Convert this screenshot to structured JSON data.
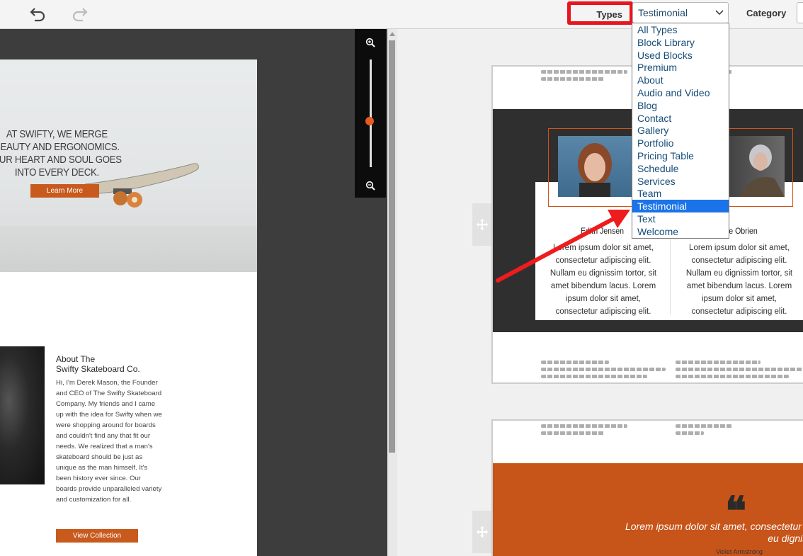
{
  "toolbar": {
    "undo_icon": "undo-icon",
    "redo_icon": "redo-icon",
    "types_label": "Types",
    "types_value": "Testimonial",
    "category_label": "Category"
  },
  "dropdown": {
    "options": [
      "All Types",
      "Block Library",
      "Used Blocks",
      "Premium",
      "About",
      "Audio and Video",
      "Blog",
      "Contact",
      "Gallery",
      "Portfolio",
      "Pricing Table",
      "Schedule",
      "Services",
      "Team",
      "Testimonial",
      "Text",
      "Welcome"
    ],
    "selected": "Testimonial"
  },
  "left_page": {
    "hero_text": "AT SWIFTY, WE MERGE BEAUTY AND ERGONOMICS. OUR HEART AND SOUL GOES INTO EVERY DECK.",
    "learn_more": "Learn More",
    "about_title_1": "About The",
    "about_title_2": "Swifty Skateboard Co.",
    "about_text": "Hi, I'm Derek Mason, the Founder and CEO of The Swifty Skateboard Company. My friends and I came up with the idea for Swifty when we were shopping around for boards and couldn't find any that fit our needs. We realized that a man's skateboard should be just as unique as the man himself. It's been history ever since. Our boards provide unparalleled variety and customization for all.",
    "view_collection": "View Collection"
  },
  "zoom": {
    "level": 0.57
  },
  "preview_testimonial": {
    "name_1": "Edith Jensen",
    "name_2": "ce Obrien",
    "text_1": "Lorem ipsum dolor sit amet, consectetur adipiscing elit. Nullam eu dignissim tortor, sit amet bibendum lacus. Lorem ipsum dolor sit amet, consectetur adipiscing elit.",
    "text_2": "Lorem ipsum dolor sit amet, consectetur adipiscing elit. Nullam eu dignissim tortor, sit amet bibendum lacus. Lorem ipsum dolor sit amet, consectetur adipiscing elit."
  },
  "preview_quote": {
    "quote_mark": "❝",
    "text": "Lorem ipsum dolor sit amet, consectetur adi Nullam eu dignissim tortor.",
    "author": "Violet Armstrong"
  },
  "colors": {
    "accent": "#c85a1e",
    "highlight": "#e8141e",
    "selection": "#1a73e8"
  }
}
